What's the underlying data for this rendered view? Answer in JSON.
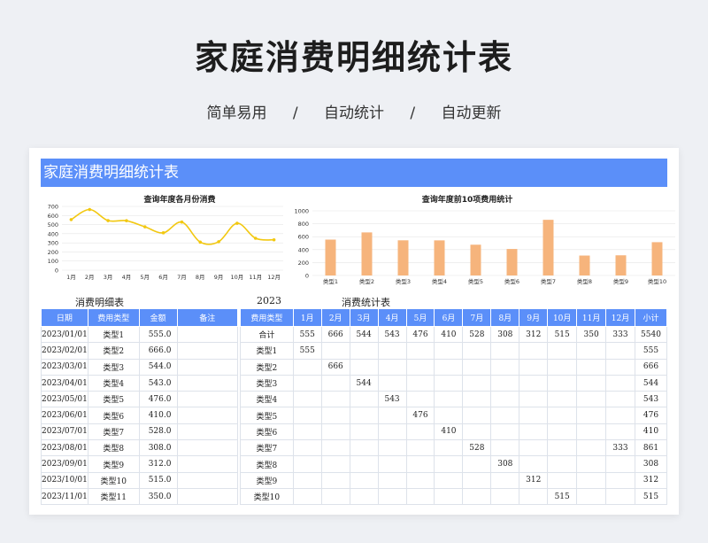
{
  "hero": {
    "title": "家庭消费明细统计表",
    "features": [
      "简单易用",
      "/",
      "自动统计",
      "/",
      "自动更新"
    ]
  },
  "sheet": {
    "banner_title": "家庭消费明细统计表",
    "detail_label": "消费明细表",
    "year": "2023",
    "stats_label": "消费统计表"
  },
  "colors": {
    "accent": "#5b8ff9",
    "line": "#f2c811",
    "bar": "#f6b47c"
  },
  "chart_data": [
    {
      "type": "line",
      "title": "查询年度各月份消费",
      "categories": [
        "1月",
        "2月",
        "3月",
        "4月",
        "5月",
        "6月",
        "7月",
        "8月",
        "9月",
        "10月",
        "11月",
        "12月"
      ],
      "values": [
        555,
        666,
        544,
        543,
        476,
        410,
        528,
        308,
        312,
        515,
        350,
        333
      ],
      "ylim": [
        0,
        700
      ],
      "yticks": [
        0,
        100,
        200,
        300,
        400,
        500,
        600,
        700
      ],
      "grid": true
    },
    {
      "type": "bar",
      "title": "查询年度前10项费用统计",
      "categories": [
        "类型1",
        "类型2",
        "类型3",
        "类型4",
        "类型5",
        "类型6",
        "类型7",
        "类型8",
        "类型9",
        "类型10"
      ],
      "values": [
        555,
        666,
        544,
        543,
        476,
        410,
        861,
        308,
        312,
        515
      ],
      "ylim": [
        0,
        1000
      ],
      "yticks": [
        0,
        200,
        400,
        600,
        800,
        1000
      ],
      "grid": true
    }
  ],
  "detail_table": {
    "headers": [
      "日期",
      "费用类型",
      "金额",
      "备注"
    ],
    "rows": [
      [
        "2023/01/01",
        "类型1",
        "555.0",
        ""
      ],
      [
        "2023/02/01",
        "类型2",
        "666.0",
        ""
      ],
      [
        "2023/03/01",
        "类型3",
        "544.0",
        ""
      ],
      [
        "2023/04/01",
        "类型4",
        "543.0",
        ""
      ],
      [
        "2023/05/01",
        "类型5",
        "476.0",
        ""
      ],
      [
        "2023/06/01",
        "类型6",
        "410.0",
        ""
      ],
      [
        "2023/07/01",
        "类型7",
        "528.0",
        ""
      ],
      [
        "2023/08/01",
        "类型8",
        "308.0",
        ""
      ],
      [
        "2023/09/01",
        "类型9",
        "312.0",
        ""
      ],
      [
        "2023/10/01",
        "类型10",
        "515.0",
        ""
      ],
      [
        "2023/11/01",
        "类型11",
        "350.0",
        ""
      ]
    ]
  },
  "stats_table": {
    "headers": [
      "费用类型",
      "1月",
      "2月",
      "3月",
      "4月",
      "5月",
      "6月",
      "7月",
      "8月",
      "9月",
      "10月",
      "11月",
      "12月",
      "小计"
    ],
    "rows": [
      [
        "合计",
        "555",
        "666",
        "544",
        "543",
        "476",
        "410",
        "528",
        "308",
        "312",
        "515",
        "350",
        "333",
        "5540"
      ],
      [
        "类型1",
        "555",
        "",
        "",
        "",
        "",
        "",
        "",
        "",
        "",
        "",
        "",
        "",
        "555"
      ],
      [
        "类型2",
        "",
        "666",
        "",
        "",
        "",
        "",
        "",
        "",
        "",
        "",
        "",
        "",
        "666"
      ],
      [
        "类型3",
        "",
        "",
        "544",
        "",
        "",
        "",
        "",
        "",
        "",
        "",
        "",
        "",
        "544"
      ],
      [
        "类型4",
        "",
        "",
        "",
        "543",
        "",
        "",
        "",
        "",
        "",
        "",
        "",
        "",
        "543"
      ],
      [
        "类型5",
        "",
        "",
        "",
        "",
        "476",
        "",
        "",
        "",
        "",
        "",
        "",
        "",
        "476"
      ],
      [
        "类型6",
        "",
        "",
        "",
        "",
        "",
        "410",
        "",
        "",
        "",
        "",
        "",
        "",
        "410"
      ],
      [
        "类型7",
        "",
        "",
        "",
        "",
        "",
        "",
        "528",
        "",
        "",
        "",
        "",
        "333",
        "861"
      ],
      [
        "类型8",
        "",
        "",
        "",
        "",
        "",
        "",
        "",
        "308",
        "",
        "",
        "",
        "",
        "308"
      ],
      [
        "类型9",
        "",
        "",
        "",
        "",
        "",
        "",
        "",
        "",
        "312",
        "",
        "",
        "",
        "312"
      ],
      [
        "类型10",
        "",
        "",
        "",
        "",
        "",
        "",
        "",
        "",
        "",
        "515",
        "",
        "",
        "515"
      ]
    ]
  }
}
